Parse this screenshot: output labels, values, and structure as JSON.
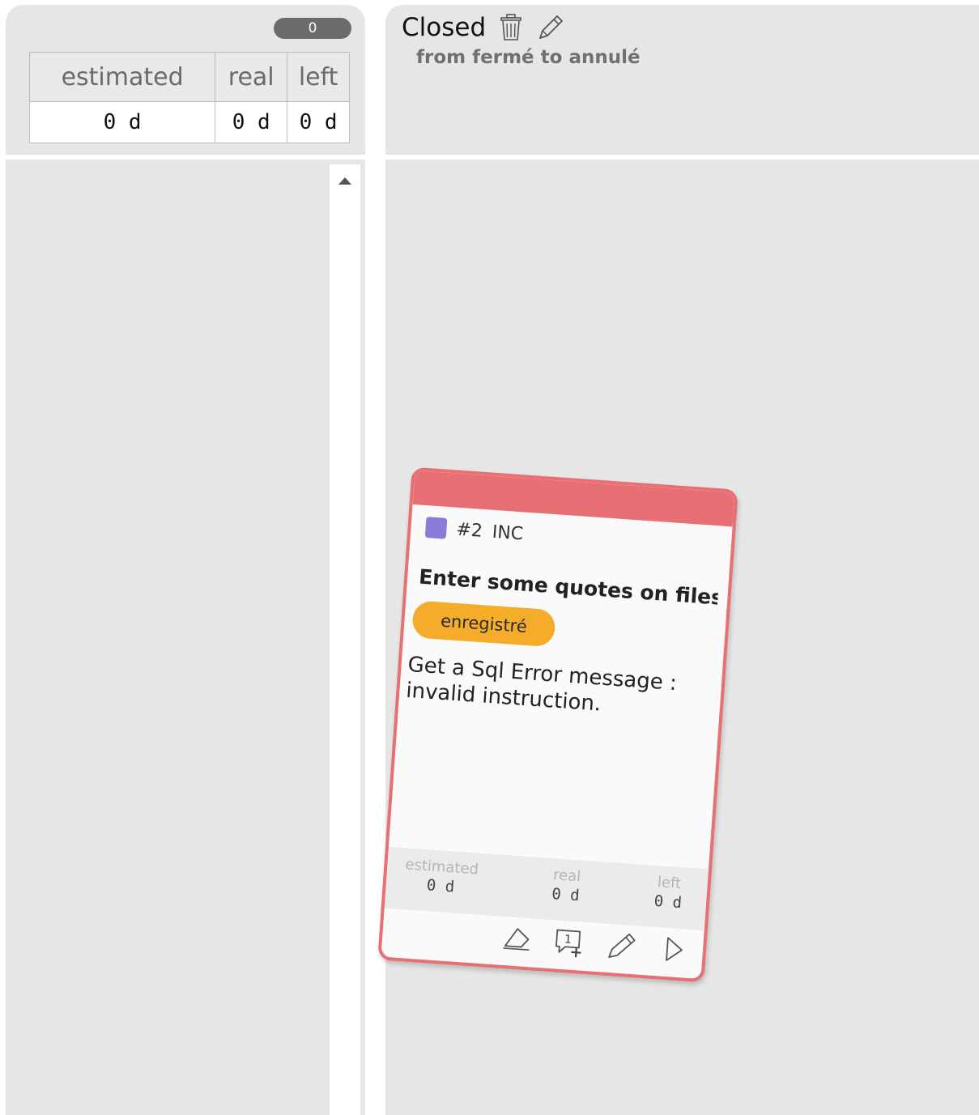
{
  "left_column": {
    "count": "0",
    "stats": {
      "headers": [
        "estimated",
        "real",
        "left"
      ],
      "values": [
        "0 d",
        "0 d",
        "0 d"
      ]
    }
  },
  "right_column": {
    "title": "Closed",
    "subtitle": "from fermé to annulé",
    "icons": [
      "trash-icon",
      "pencil-icon"
    ]
  },
  "card": {
    "type_color": "#8a7bd8",
    "id": "#2",
    "type": "INC",
    "title": "Enter some quotes on files",
    "status": "enregistré",
    "status_color": "#f5ac2a",
    "accent_color": "#e86f73",
    "description": "Get a Sql Error message : invalid instruction.",
    "stats": [
      {
        "label": "estimated",
        "value": "0 d"
      },
      {
        "label": "real",
        "value": "0 d"
      },
      {
        "label": "left",
        "value": "0 d"
      }
    ],
    "comment_count": "1",
    "actions": [
      "eraser-icon",
      "add-comment-icon",
      "pencil-icon",
      "play-icon"
    ]
  }
}
